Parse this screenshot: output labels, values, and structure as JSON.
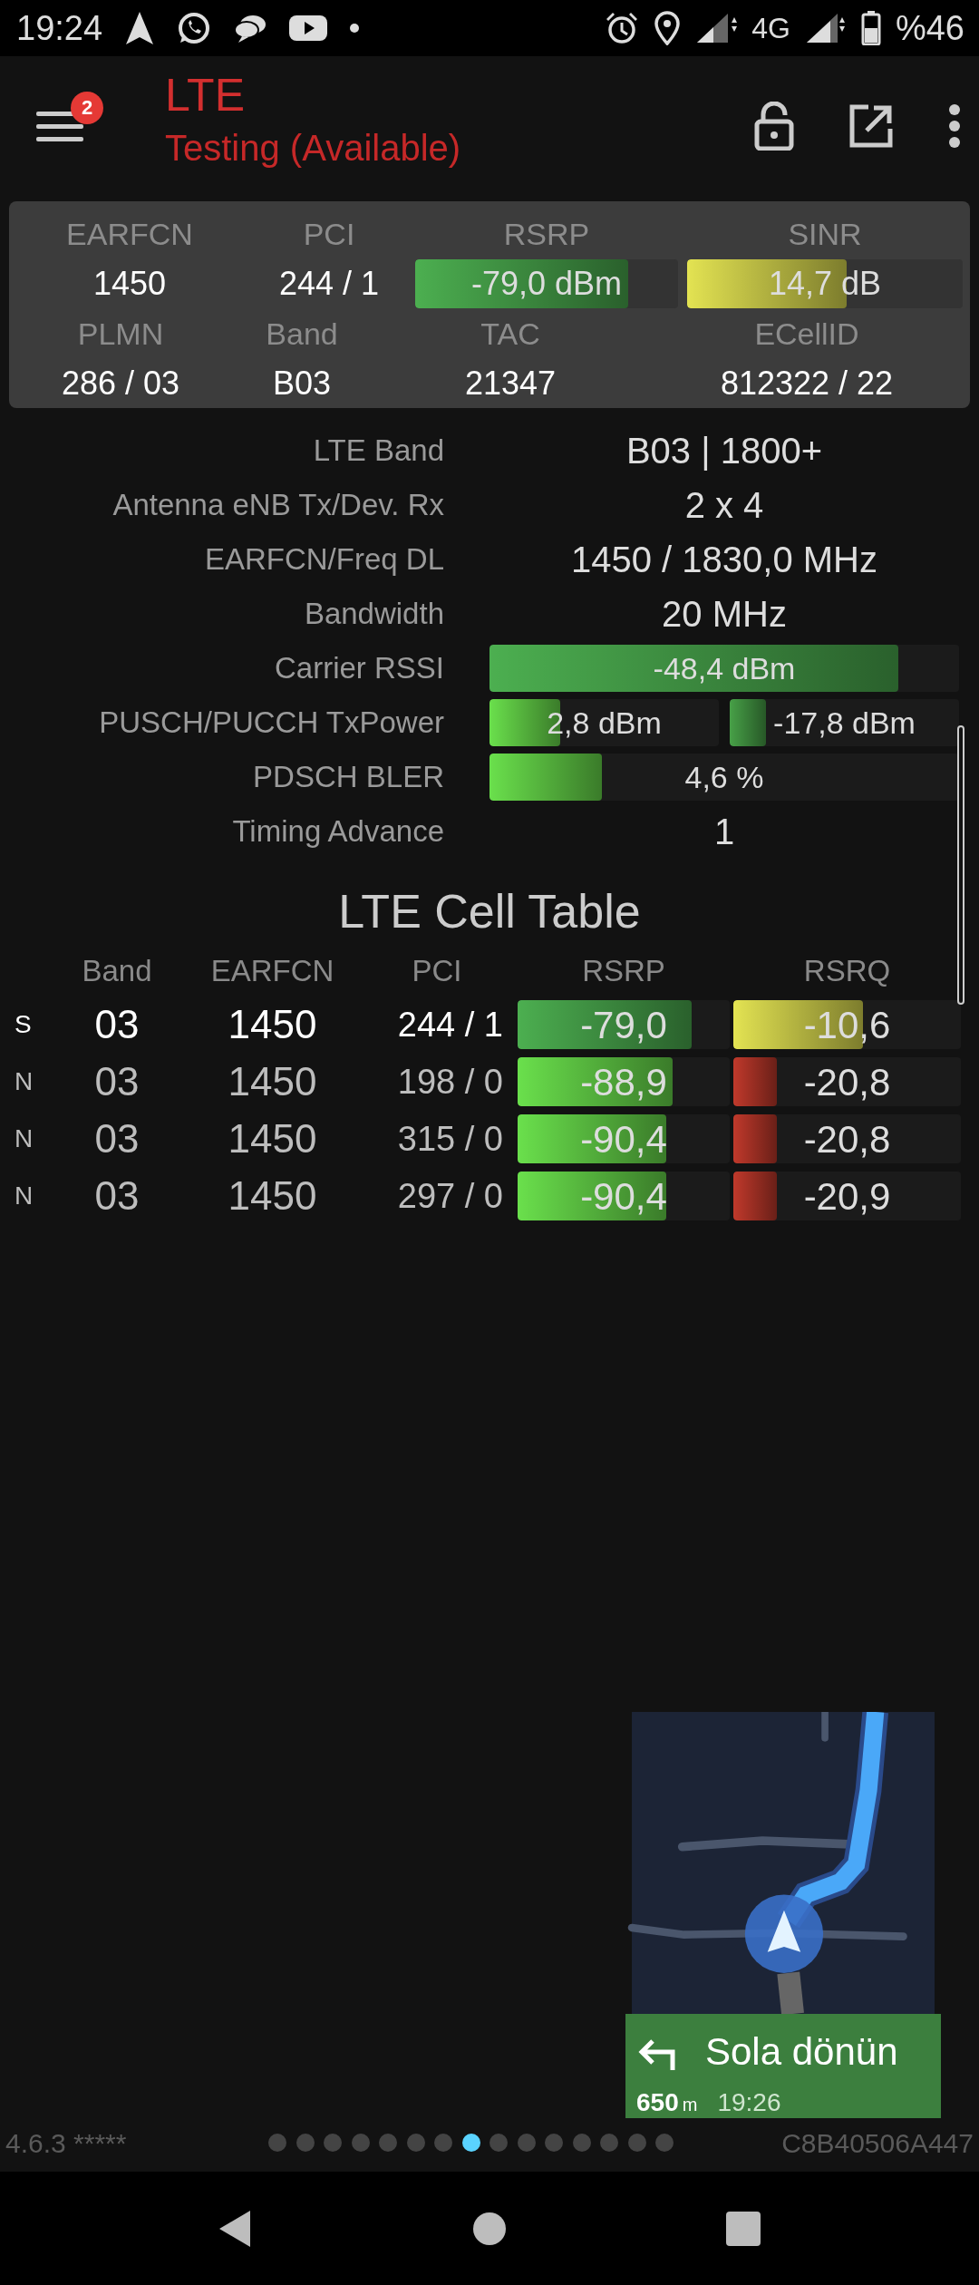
{
  "status_bar": {
    "time": "19:24",
    "network": "4G",
    "battery": "%46"
  },
  "header": {
    "notification_count": "2",
    "title": "LTE",
    "subtitle": "Testing (Available)"
  },
  "summary": {
    "row_1": [
      {
        "label": "EARFCN",
        "kind": "text",
        "value": "1450"
      },
      {
        "label": "PCI",
        "kind": "text",
        "value": "244 / 1"
      },
      {
        "label": "RSRP",
        "kind": "meter",
        "value": "-79,0 dBm",
        "level": 0.81,
        "color": "#4caf50"
      },
      {
        "label": "SINR",
        "kind": "meter",
        "value": "14,7 dB",
        "level": 0.58,
        "color": "#e3e352"
      }
    ],
    "row_2": [
      {
        "label": "PLMN",
        "kind": "text",
        "value": "286 / 03"
      },
      {
        "label": "Band",
        "kind": "text",
        "value": "B03"
      },
      {
        "label": "TAC",
        "kind": "text",
        "value": "21347"
      },
      {
        "label": "ECellID",
        "kind": "text",
        "value": "812322 / 22"
      }
    ]
  },
  "details": [
    {
      "label": "LTE Band",
      "kind": "text",
      "value": "B03 | 1800+"
    },
    {
      "label": "Antenna eNB Tx/Dev. Rx",
      "kind": "text",
      "value": "2 x 4"
    },
    {
      "label": "EARFCN/Freq DL",
      "kind": "text",
      "value": "1450 / 1830,0 MHz"
    },
    {
      "label": "Bandwidth",
      "kind": "text",
      "value": "20 MHz"
    },
    {
      "label": "Carrier RSSI",
      "kind": "meter",
      "meters": [
        {
          "value": "-48,4 dBm",
          "level": 0.87,
          "color": "#4caf50"
        }
      ]
    },
    {
      "label": "PUSCH/PUCCH TxPower",
      "kind": "meter",
      "meters": [
        {
          "value": "2,8 dBm",
          "level": 0.31,
          "color": "#6ae04c"
        },
        {
          "value": "-17,8 dBm",
          "level": 0.16,
          "color": "#47a047"
        }
      ]
    },
    {
      "label": "PDSCH BLER",
      "kind": "meter",
      "meters": [
        {
          "value": "4,6 %",
          "level": 0.24,
          "color": "#6ae04c"
        }
      ]
    },
    {
      "label": "Timing Advance",
      "kind": "text",
      "value": "1"
    }
  ],
  "cell_table": {
    "title": "LTE Cell Table",
    "columns": [
      "Band",
      "EARFCN",
      "PCI",
      "RSRP",
      "RSRQ"
    ],
    "rows": [
      {
        "type": "S",
        "highlighted": true,
        "band": "03",
        "earfcn": "1450",
        "pci": "244 / 1",
        "rsrp": {
          "value": "-79,0",
          "level": 0.82,
          "color": "#4caf50"
        },
        "rsrq": {
          "value": "-10,6",
          "level": 0.57,
          "color": "#e3e352"
        }
      },
      {
        "type": "N",
        "highlighted": false,
        "band": "03",
        "earfcn": "1450",
        "pci": "198 / 0",
        "rsrp": {
          "value": "-88,9",
          "level": 0.73,
          "color": "#6ae04c"
        },
        "rsrq": {
          "value": "-20,8",
          "level": 0.19,
          "color": "#c0392b"
        }
      },
      {
        "type": "N",
        "highlighted": false,
        "band": "03",
        "earfcn": "1450",
        "pci": "315 / 0",
        "rsrp": {
          "value": "-90,4",
          "level": 0.7,
          "color": "#6ae04c"
        },
        "rsrq": {
          "value": "-20,8",
          "level": 0.19,
          "color": "#c0392b"
        }
      },
      {
        "type": "N",
        "highlighted": false,
        "band": "03",
        "earfcn": "1450",
        "pci": "297 / 0",
        "rsrp": {
          "value": "-90,4",
          "level": 0.7,
          "color": "#6ae04c"
        },
        "rsrq": {
          "value": "-20,9",
          "level": 0.19,
          "color": "#c0392b"
        }
      }
    ]
  },
  "navigation_overlay": {
    "instruction": "Sola dönün",
    "distance": "650",
    "unit": "m",
    "eta": "19:26"
  },
  "footer": {
    "version": "4.6.3 *****",
    "page_dots": [
      {
        "selected": false
      },
      {
        "selected": false
      },
      {
        "selected": false
      },
      {
        "selected": false
      },
      {
        "selected": false
      },
      {
        "selected": false
      },
      {
        "selected": false
      },
      {
        "selected": true
      },
      {
        "selected": false
      },
      {
        "selected": false
      },
      {
        "selected": false
      },
      {
        "selected": false
      },
      {
        "selected": false
      },
      {
        "selected": false
      },
      {
        "selected": false
      }
    ],
    "device_id": "C8B40506A447"
  }
}
